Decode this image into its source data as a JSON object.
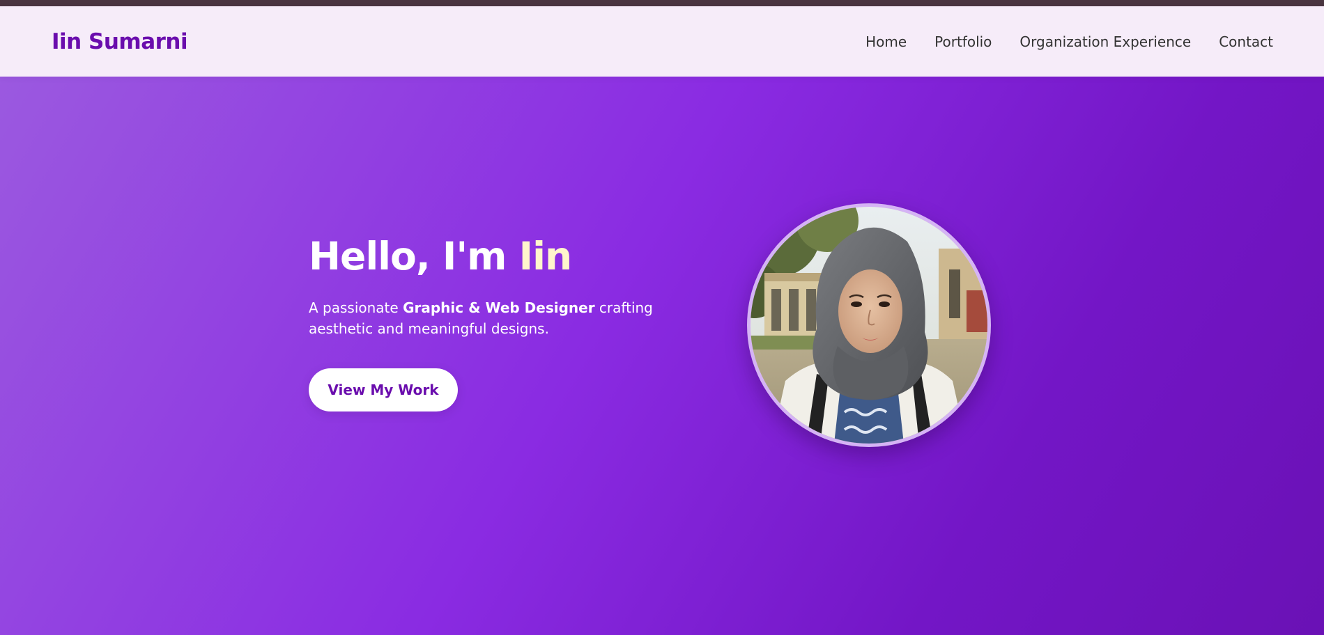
{
  "header": {
    "brand": "Iin Sumarni",
    "nav": [
      {
        "label": "Home"
      },
      {
        "label": "Portfolio"
      },
      {
        "label": "Organization Experience"
      },
      {
        "label": "Contact"
      }
    ]
  },
  "hero": {
    "title_prefix": "Hello, I'm ",
    "title_name": "Iin",
    "subtitle_prefix": "A passionate ",
    "subtitle_emphasis": "Graphic & Web Designer",
    "subtitle_suffix": " crafting aesthetic and meaningful designs.",
    "cta_label": "View My Work"
  },
  "colors": {
    "brand": "#6a0dad",
    "hero_gradient_start": "#9b59e0",
    "hero_gradient_end": "#6a11b5",
    "navbar_bg": "#f6ecf9",
    "accent_name": "#fff6cc"
  },
  "images": {
    "profile_photo": "profile-photo"
  }
}
